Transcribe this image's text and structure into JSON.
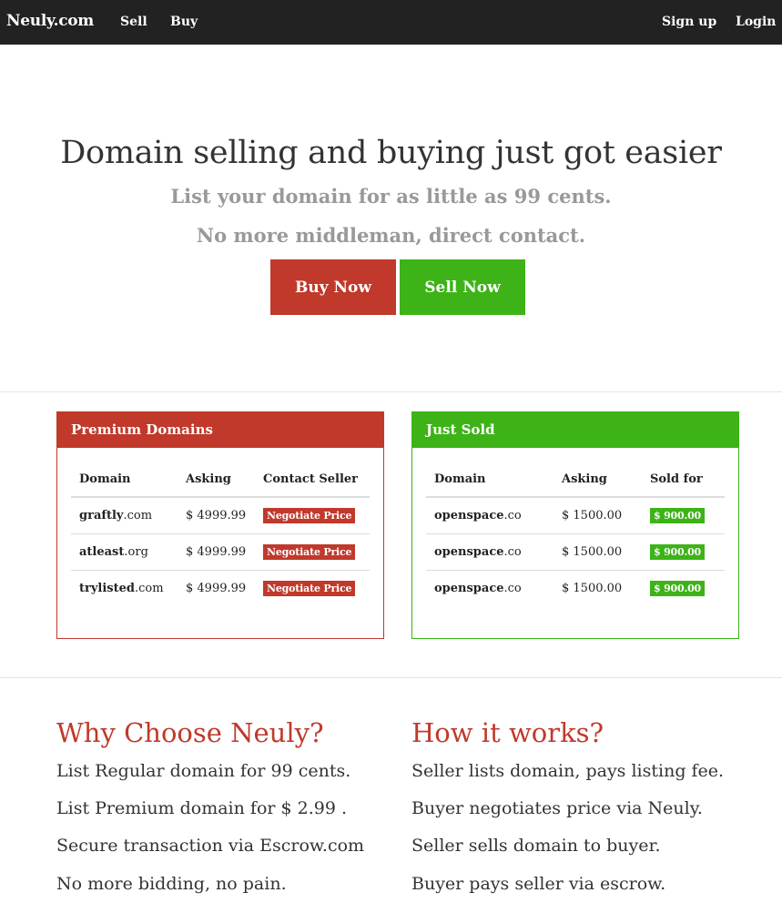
{
  "navbar": {
    "brand": "Neuly.com",
    "left_links": [
      "Sell",
      "Buy"
    ],
    "right_links": [
      "Sign up",
      "Login"
    ]
  },
  "hero": {
    "title": "Domain selling and buying just got easier",
    "subtitle_1": "List your domain for as little as 99 cents.",
    "subtitle_2": "No more middleman, direct contact.",
    "buy_button": "Buy Now",
    "sell_button": "Sell Now"
  },
  "premium": {
    "heading": "Premium Domains",
    "columns": [
      "Domain",
      "Asking",
      "Contact Seller"
    ],
    "rows": [
      {
        "name": "graftly",
        "tld": ".com",
        "asking": "$ 4999.99",
        "action": "Negotiate Price"
      },
      {
        "name": "atleast",
        "tld": ".org",
        "asking": "$ 4999.99",
        "action": "Negotiate Price"
      },
      {
        "name": "trylisted",
        "tld": ".com",
        "asking": "$ 4999.99",
        "action": "Negotiate Price"
      }
    ]
  },
  "sold": {
    "heading": "Just Sold",
    "columns": [
      "Domain",
      "Asking",
      "Sold for"
    ],
    "rows": [
      {
        "name": "openspace",
        "tld": ".co",
        "asking": "$ 1500.00",
        "sold": "$ 900.00"
      },
      {
        "name": "openspace",
        "tld": ".co",
        "asking": "$ 1500.00",
        "sold": "$ 900.00"
      },
      {
        "name": "openspace",
        "tld": ".co",
        "asking": "$ 1500.00",
        "sold": "$ 900.00"
      }
    ]
  },
  "why": {
    "title": "Why Choose Neuly?",
    "lines": [
      "List Regular domain for 99 cents.",
      "List Premium domain for $ 2.99 .",
      "Secure transaction via Escrow.com",
      "No more bidding, no pain."
    ]
  },
  "how": {
    "title": "How it works?",
    "lines": [
      "Seller lists domain, pays listing fee.",
      "Buyer negotiates price via Neuly.",
      "Seller sells domain to buyer.",
      "Buyer pays seller via escrow."
    ]
  },
  "colors": {
    "navbar": "#222222",
    "red": "#c0392b",
    "green": "#3db318"
  }
}
